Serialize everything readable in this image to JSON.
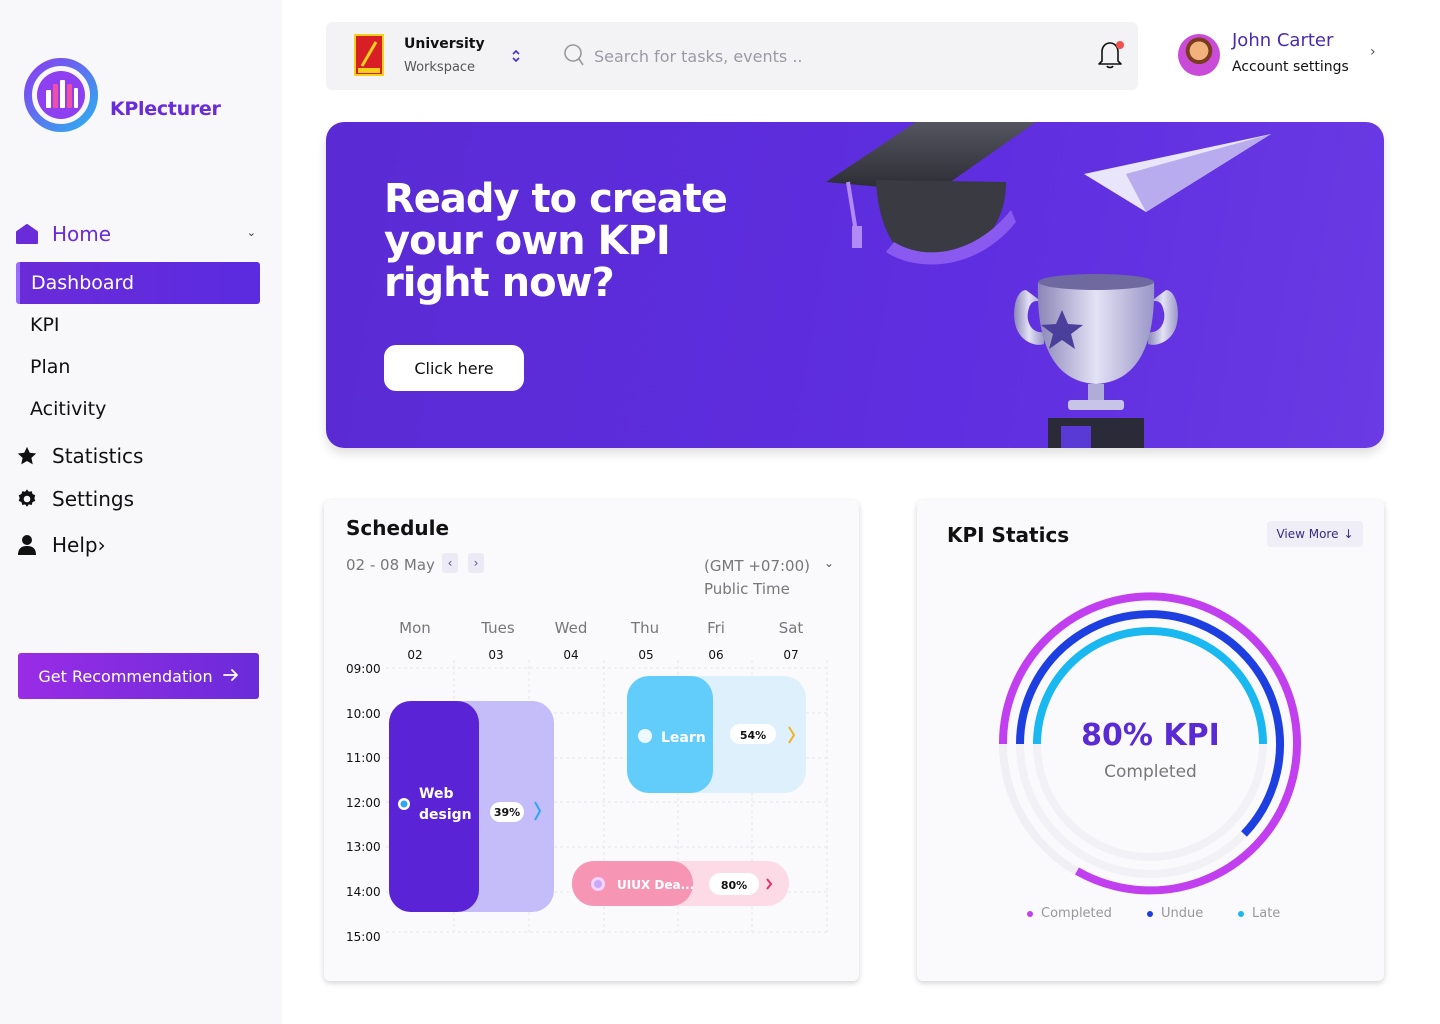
{
  "sidebar": {
    "brand": "KPlecturer",
    "home_label": "Home",
    "sub_items": [
      "Dashboard",
      "KPI",
      "Plan",
      "Acitivity"
    ],
    "statistics_label": "Statistics",
    "settings_label": "Settings",
    "help_label": "Help",
    "recommend_label": "Get Recommendation"
  },
  "topbar": {
    "workspace_title": "University",
    "workspace_sub": "Workspace",
    "search_placeholder": "Search for tasks, events ..",
    "user_name": "John Carter",
    "account_settings": "Account settings"
  },
  "hero": {
    "title": "Ready to create your own KPI right now?",
    "button_label": "Click here"
  },
  "schedule": {
    "title": "Schedule",
    "range": "02 - 08 May",
    "timezone_line1": "(GMT +07:00)",
    "timezone_line2": "Public Time",
    "days": [
      {
        "name": "Mon",
        "date": "02"
      },
      {
        "name": "Tues",
        "date": "03"
      },
      {
        "name": "Wed",
        "date": "04"
      },
      {
        "name": "Thu",
        "date": "05"
      },
      {
        "name": "Fri",
        "date": "06"
      },
      {
        "name": "Sat",
        "date": "07"
      }
    ],
    "hours": [
      "09:00",
      "10:00",
      "11:00",
      "12:00",
      "13:00",
      "14:00",
      "15:00"
    ],
    "events": [
      {
        "title_line1": "Web",
        "title_line2": "design",
        "progress": "39%"
      },
      {
        "title_line1": "Learn",
        "title_line2": "",
        "progress": "54%"
      },
      {
        "title_line1": "UIUX Dea...",
        "title_line2": "",
        "progress": "80%"
      }
    ]
  },
  "kpi": {
    "title": "KPI Statics",
    "view_more": "View More",
    "value": "80% KPI",
    "subtitle": "Completed",
    "legend": [
      {
        "label": "Completed",
        "color": "#c23ff0"
      },
      {
        "label": "Undue",
        "color": "#1e3fe0"
      },
      {
        "label": "Late",
        "color": "#1ab8f0"
      }
    ]
  },
  "colors": {
    "brand_purple": "#6a2bd9",
    "hero_bg": "#5a2bd4"
  }
}
